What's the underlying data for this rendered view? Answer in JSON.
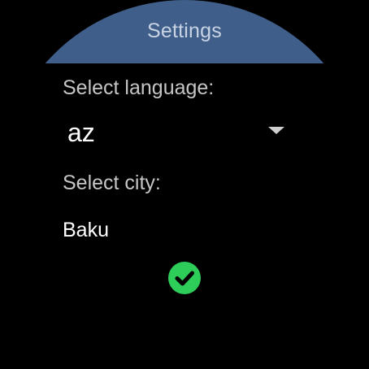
{
  "header": {
    "title": "Settings",
    "color": "#3f5f8a"
  },
  "language": {
    "label": "Select language:",
    "selected": "az",
    "icon": "chevron-down-icon"
  },
  "city": {
    "label": "Select city:",
    "value": "Baku"
  },
  "confirm": {
    "icon": "check-icon",
    "color": "#2ecc58"
  }
}
